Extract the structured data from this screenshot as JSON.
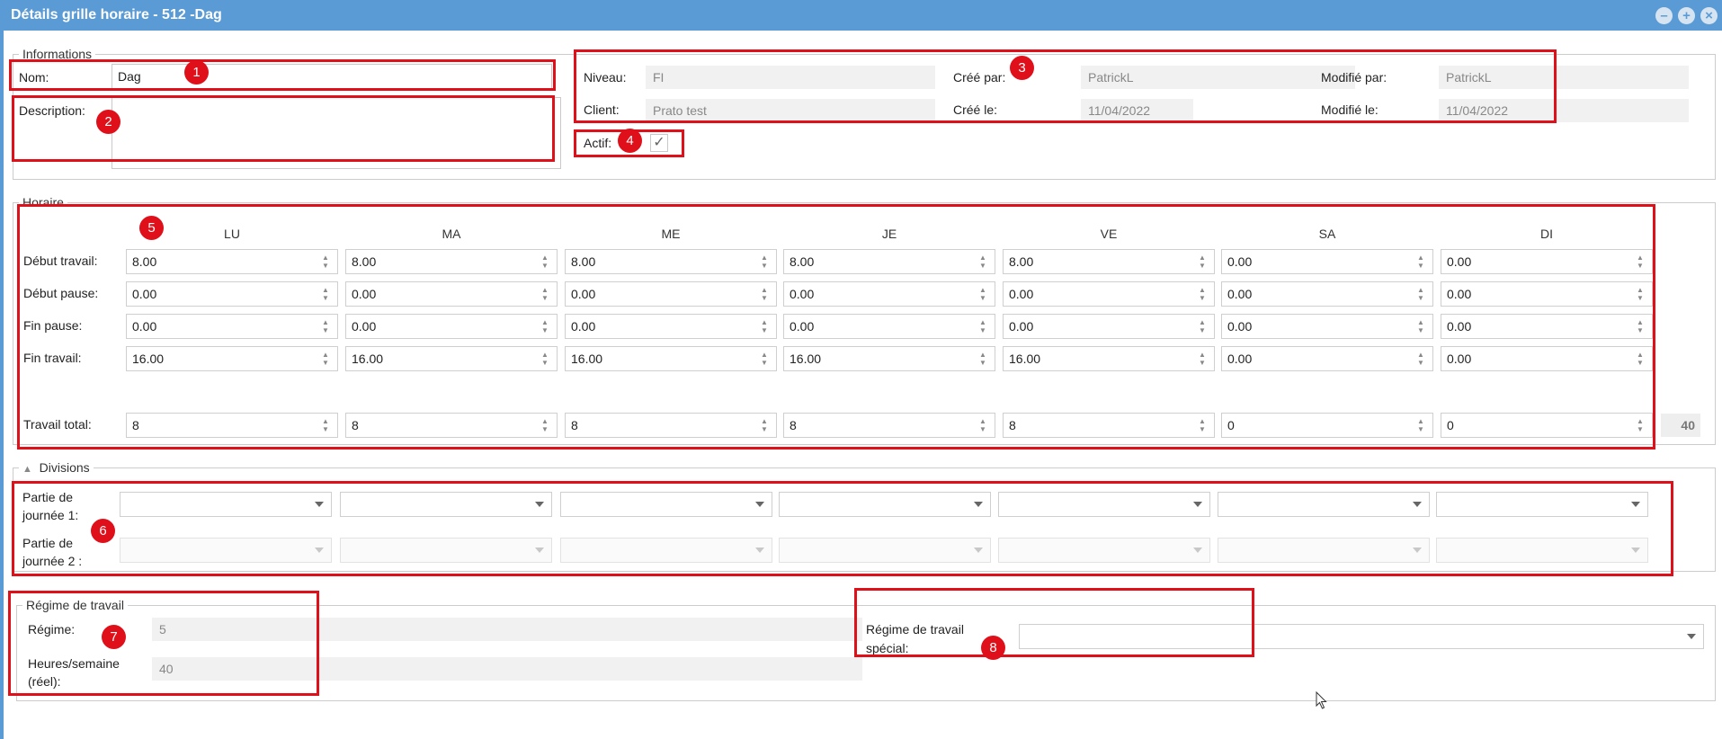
{
  "window": {
    "title": "Détails grille horaire - 512 -Dag",
    "title_bar_color": "#5b9bd5",
    "controls": [
      "minimize-icon",
      "maximize-icon",
      "close-icon"
    ]
  },
  "informations": {
    "legend": "Informations",
    "nom_label": "Nom:",
    "nom_value": "Dag",
    "description_label": "Description:",
    "description_value": "",
    "niveau_label": "Niveau:",
    "niveau_value": "FI",
    "client_label": "Client:",
    "client_value": "Prato test",
    "cree_par_label": "Créé par:",
    "cree_par_value": "PatrickL",
    "cree_le_label": "Créé le:",
    "cree_le_value": "11/04/2022",
    "modifie_par_label": "Modifié par:",
    "modifie_par_value": "PatrickL",
    "modifie_le_label": "Modifié le:",
    "modifie_le_value": "11/04/2022",
    "actif_label": "Actif:",
    "actif_checked": true,
    "check_glyph": "✓"
  },
  "horaire": {
    "legend": "Horaire",
    "days": [
      "LU",
      "MA",
      "ME",
      "JE",
      "VE",
      "SA",
      "DI"
    ],
    "rows": [
      {
        "label": "Début travail:",
        "values": [
          "8.00",
          "8.00",
          "8.00",
          "8.00",
          "8.00",
          "0.00",
          "0.00"
        ]
      },
      {
        "label": "Début pause:",
        "values": [
          "0.00",
          "0.00",
          "0.00",
          "0.00",
          "0.00",
          "0.00",
          "0.00"
        ]
      },
      {
        "label": "Fin pause:",
        "values": [
          "0.00",
          "0.00",
          "0.00",
          "0.00",
          "0.00",
          "0.00",
          "0.00"
        ]
      },
      {
        "label": "Fin travail:",
        "values": [
          "16.00",
          "16.00",
          "16.00",
          "16.00",
          "16.00",
          "0.00",
          "0.00"
        ]
      }
    ],
    "total_row": {
      "label": "Travail total:",
      "values": [
        "8",
        "8",
        "8",
        "8",
        "8",
        "0",
        "0"
      ]
    },
    "grand_total": "40"
  },
  "divisions": {
    "legend": "Divisions",
    "collapse_icon": "triangle-up-icon",
    "partie1_label_line1": "Partie de",
    "partie1_label_line2": "journée 1:",
    "partie2_label_line1": "Partie de",
    "partie2_label_line2": "journée 2 :"
  },
  "regime": {
    "legend": "Régime de travail",
    "regime_label": "Régime:",
    "regime_value": "5",
    "heures_label_line1": "Heures/semaine",
    "heures_label_line2": "(réel):",
    "heures_value": "40",
    "special_label_line1": "Régime de travail",
    "special_label_line2": "spécial:",
    "special_value": ""
  },
  "annotations": {
    "color": "#e0101a",
    "badges": [
      "1",
      "2",
      "3",
      "4",
      "5",
      "6",
      "7",
      "8"
    ]
  }
}
